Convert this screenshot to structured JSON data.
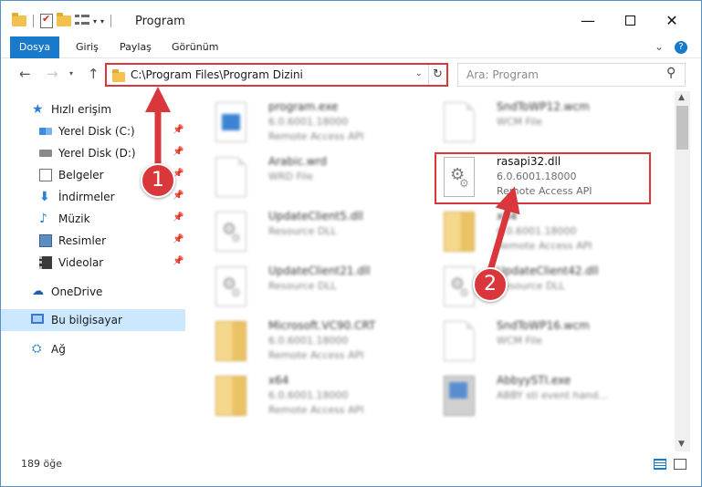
{
  "window": {
    "title": "Program",
    "minimize_glyph": "—",
    "close_glyph": "✕"
  },
  "ribbon": {
    "tabs": [
      "Dosya",
      "Giriş",
      "Paylaş",
      "Görünüm"
    ],
    "help_glyph": "?"
  },
  "address": {
    "path": "C:\\Program Files\\Program Dizini",
    "search_placeholder": "Ara: Program"
  },
  "sidebar": {
    "quick_access": "Hızlı erişim",
    "items": [
      "Yerel Disk (C:)",
      "Yerel Disk (D:)",
      "Belgeler",
      "İndirmeler",
      "Müzik",
      "Resimler",
      "Videolar"
    ],
    "onedrive": "OneDrive",
    "this_pc": "Bu bilgisayar",
    "network": "Ağ"
  },
  "files": [
    {
      "name": "program.exe",
      "type": "6.0.6001.18000",
      "desc": "Remote Access API",
      "icon": "exe-icon"
    },
    {
      "name": "SndToWP12.wcm",
      "type": "WCM File",
      "desc": "",
      "icon": "page-icon"
    },
    {
      "name": "Arabic.wrd",
      "type": "WRD File",
      "desc": "",
      "icon": "page-icon"
    },
    {
      "name": "rasapi32.dll",
      "type": "6.0.6001.18000",
      "desc": "Remote Access API",
      "icon": "dll-gear-icon"
    },
    {
      "name": "UpdateClient5.dll",
      "type": "Resource DLL",
      "desc": "",
      "icon": "dll-gear-icon"
    },
    {
      "name": "x64",
      "type": "6.0.6001.18000",
      "desc": "Remote Access API",
      "icon": "zip-folder-icon"
    },
    {
      "name": "UpdateClient21.dll",
      "type": "Resource DLL",
      "desc": "",
      "icon": "dll-gear-icon"
    },
    {
      "name": "UpdateClient42.dll",
      "type": "Resource DLL",
      "desc": "",
      "icon": "dll-gear-icon"
    },
    {
      "name": "Microsoft.VC90.CRT",
      "type": "6.0.6001.18000",
      "desc": "Remote Access API",
      "icon": "zip-folder-icon"
    },
    {
      "name": "SndToWP16.wcm",
      "type": "WCM File",
      "desc": "",
      "icon": "page-icon"
    },
    {
      "name": "x64",
      "type": "6.0.6001.18000",
      "desc": "Remote Access API",
      "icon": "zip-folder-icon"
    },
    {
      "name": "AbbyySTI.exe",
      "type": "ABBY sti event hand...",
      "desc": "",
      "icon": "app-icon"
    }
  ],
  "status": {
    "item_count": "189 öğe"
  },
  "annotations": {
    "step1": "1",
    "step2": "2",
    "color": "#d9373c"
  },
  "colors": {
    "accent": "#1979ca",
    "selected": "#cce8ff"
  }
}
